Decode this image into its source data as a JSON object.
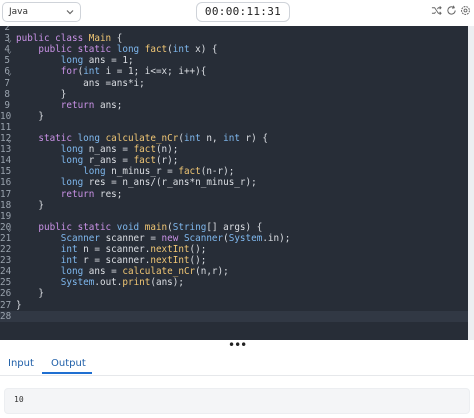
{
  "toolbar": {
    "language": "Java",
    "timer": "00:00:11:31",
    "icons": [
      "chevron-down-icon",
      "shuffle-icon",
      "refresh-icon",
      "settings-icon"
    ]
  },
  "editor": {
    "theme_bg": "#272d37",
    "lines": [
      {
        "num": "2",
        "fold": false,
        "tokens": [
          {
            "t": ""
          }
        ]
      },
      {
        "num": "3",
        "fold": true,
        "tokens": [
          {
            "t": "public class ",
            "c": "kw"
          },
          {
            "t": "Main",
            "c": "fn"
          },
          {
            "t": " {"
          }
        ]
      },
      {
        "num": "4",
        "fold": true,
        "tokens": [
          {
            "t": "    public static ",
            "c": "kw"
          },
          {
            "t": "long ",
            "c": "ty"
          },
          {
            "t": "fact",
            "c": "fn"
          },
          {
            "t": "("
          },
          {
            "t": "int ",
            "c": "ty"
          },
          {
            "t": "x) {"
          }
        ]
      },
      {
        "num": "5",
        "fold": false,
        "tokens": [
          {
            "t": "        "
          },
          {
            "t": "long ",
            "c": "ty"
          },
          {
            "t": "ans = 1;"
          }
        ]
      },
      {
        "num": "6",
        "fold": true,
        "tokens": [
          {
            "t": "        "
          },
          {
            "t": "for",
            "c": "kw"
          },
          {
            "t": "("
          },
          {
            "t": "int ",
            "c": "ty"
          },
          {
            "t": "i = 1; i<=x; i++){"
          }
        ]
      },
      {
        "num": "7",
        "fold": false,
        "tokens": [
          {
            "t": "            ans =ans*i;"
          }
        ]
      },
      {
        "num": "8",
        "fold": false,
        "tokens": [
          {
            "t": "        }"
          }
        ]
      },
      {
        "num": "9",
        "fold": false,
        "tokens": [
          {
            "t": "        "
          },
          {
            "t": "return ",
            "c": "kw"
          },
          {
            "t": "ans;"
          }
        ]
      },
      {
        "num": "10",
        "fold": false,
        "tokens": [
          {
            "t": "    }"
          }
        ]
      },
      {
        "num": "11",
        "fold": false,
        "tokens": [
          {
            "t": ""
          }
        ]
      },
      {
        "num": "12",
        "fold": true,
        "tokens": [
          {
            "t": "    static ",
            "c": "kw"
          },
          {
            "t": "long ",
            "c": "ty"
          },
          {
            "t": "calculate_nCr",
            "c": "fn"
          },
          {
            "t": "("
          },
          {
            "t": "int ",
            "c": "ty"
          },
          {
            "t": "n, "
          },
          {
            "t": "int ",
            "c": "ty"
          },
          {
            "t": "r) {"
          }
        ]
      },
      {
        "num": "13",
        "fold": false,
        "tokens": [
          {
            "t": "        "
          },
          {
            "t": "long ",
            "c": "ty"
          },
          {
            "t": "n_ans = "
          },
          {
            "t": "fact",
            "c": "fn"
          },
          {
            "t": "(n);"
          }
        ]
      },
      {
        "num": "14",
        "fold": false,
        "tokens": [
          {
            "t": "        "
          },
          {
            "t": "long ",
            "c": "ty"
          },
          {
            "t": "r_ans = "
          },
          {
            "t": "fact",
            "c": "fn"
          },
          {
            "t": "(r);"
          }
        ]
      },
      {
        "num": "15",
        "fold": false,
        "tokens": [
          {
            "t": "            "
          },
          {
            "t": "long ",
            "c": "ty"
          },
          {
            "t": "n_minus_r = "
          },
          {
            "t": "fact",
            "c": "fn"
          },
          {
            "t": "(n-r);"
          }
        ]
      },
      {
        "num": "16",
        "fold": false,
        "tokens": [
          {
            "t": "        "
          },
          {
            "t": "long ",
            "c": "ty"
          },
          {
            "t": "res = n_ans/(r_ans*n_minus_r);"
          }
        ]
      },
      {
        "num": "17",
        "fold": false,
        "tokens": [
          {
            "t": "        "
          },
          {
            "t": "return ",
            "c": "kw"
          },
          {
            "t": "res;"
          }
        ]
      },
      {
        "num": "18",
        "fold": false,
        "tokens": [
          {
            "t": "    }"
          }
        ]
      },
      {
        "num": "19",
        "fold": false,
        "tokens": [
          {
            "t": ""
          }
        ]
      },
      {
        "num": "20",
        "fold": true,
        "tokens": [
          {
            "t": "    public static ",
            "c": "kw"
          },
          {
            "t": "void ",
            "c": "ty"
          },
          {
            "t": "main",
            "c": "fn"
          },
          {
            "t": "("
          },
          {
            "t": "String",
            "c": "ty"
          },
          {
            "t": "[] args) {"
          }
        ]
      },
      {
        "num": "21",
        "fold": false,
        "tokens": [
          {
            "t": "        "
          },
          {
            "t": "Scanner ",
            "c": "ty"
          },
          {
            "t": "scanner = "
          },
          {
            "t": "new ",
            "c": "kw"
          },
          {
            "t": "Scanner",
            "c": "ty"
          },
          {
            "t": "("
          },
          {
            "t": "System",
            "c": "ty"
          },
          {
            "t": ".in);"
          }
        ]
      },
      {
        "num": "22",
        "fold": false,
        "tokens": [
          {
            "t": "        "
          },
          {
            "t": "int ",
            "c": "ty"
          },
          {
            "t": "n = scanner."
          },
          {
            "t": "nextInt",
            "c": "fn"
          },
          {
            "t": "();"
          }
        ]
      },
      {
        "num": "23",
        "fold": false,
        "tokens": [
          {
            "t": "        "
          },
          {
            "t": "int ",
            "c": "ty"
          },
          {
            "t": "r = scanner."
          },
          {
            "t": "nextInt",
            "c": "fn"
          },
          {
            "t": "();"
          }
        ]
      },
      {
        "num": "24",
        "fold": false,
        "tokens": [
          {
            "t": "        "
          },
          {
            "t": "long ",
            "c": "ty"
          },
          {
            "t": "ans = "
          },
          {
            "t": "calculate_nCr",
            "c": "fn"
          },
          {
            "t": "(n,r);"
          }
        ]
      },
      {
        "num": "25",
        "fold": false,
        "tokens": [
          {
            "t": "        "
          },
          {
            "t": "System",
            "c": "ty"
          },
          {
            "t": ".out."
          },
          {
            "t": "print",
            "c": "fn"
          },
          {
            "t": "(ans);"
          }
        ]
      },
      {
        "num": "26",
        "fold": false,
        "tokens": [
          {
            "t": "    }"
          }
        ]
      },
      {
        "num": "27",
        "fold": false,
        "tokens": [
          {
            "t": "}"
          }
        ]
      },
      {
        "num": "28",
        "fold": false,
        "active": true,
        "tokens": [
          {
            "t": ""
          }
        ]
      }
    ]
  },
  "tabs": [
    {
      "label": "Input",
      "active": false
    },
    {
      "label": "Output",
      "active": true
    }
  ],
  "output": {
    "text": "10"
  }
}
